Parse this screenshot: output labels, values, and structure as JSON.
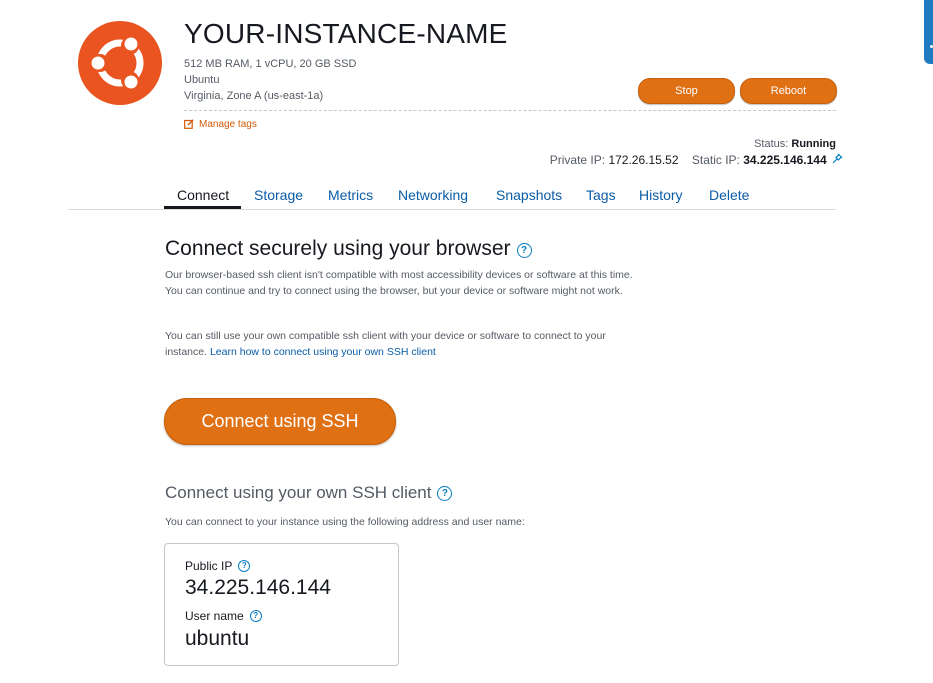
{
  "instance": {
    "name": "YOUR-INSTANCE-NAME",
    "specs": "512 MB RAM, 1 vCPU, 20 GB SSD",
    "os": "Ubuntu",
    "location": "Virginia, Zone A (us-east-1a)",
    "manage_tags_label": "Manage tags"
  },
  "actions": {
    "stop_label": "Stop",
    "reboot_label": "Reboot"
  },
  "status": {
    "label": "Status:",
    "value": "Running",
    "private_ip_label": "Private IP:",
    "private_ip": "172.26.15.52",
    "static_ip_label": "Static IP:",
    "static_ip": "34.225.146.144"
  },
  "tabs": [
    {
      "label": "Connect"
    },
    {
      "label": "Storage"
    },
    {
      "label": "Metrics"
    },
    {
      "label": "Networking"
    },
    {
      "label": "Snapshots"
    },
    {
      "label": "Tags"
    },
    {
      "label": "History"
    },
    {
      "label": "Delete"
    }
  ],
  "browser_section": {
    "heading": "Connect securely using your browser",
    "para1": "Our browser-based ssh client isn't compatible with most accessibility devices or software at this time. You can continue and try to connect using the browser, but your device or software might not work.",
    "para2": "You can still use your own compatible ssh client with your device or software to connect to your instance.",
    "link": "Learn how to connect using your own SSH client",
    "button": "Connect using SSH"
  },
  "own_client_section": {
    "heading": "Connect using your own SSH client",
    "desc": "You can connect to your instance using the following address and user name:",
    "public_ip_label": "Public IP",
    "public_ip": "34.225.146.144",
    "user_name_label": "User name",
    "user_name": "ubuntu"
  },
  "colors": {
    "accent": "#e07014",
    "link": "#0a5ca8",
    "brand_logo": "#e95420"
  },
  "icons": [
    "ubuntu-logo-icon",
    "edit-icon",
    "pin-icon",
    "help-icon"
  ]
}
